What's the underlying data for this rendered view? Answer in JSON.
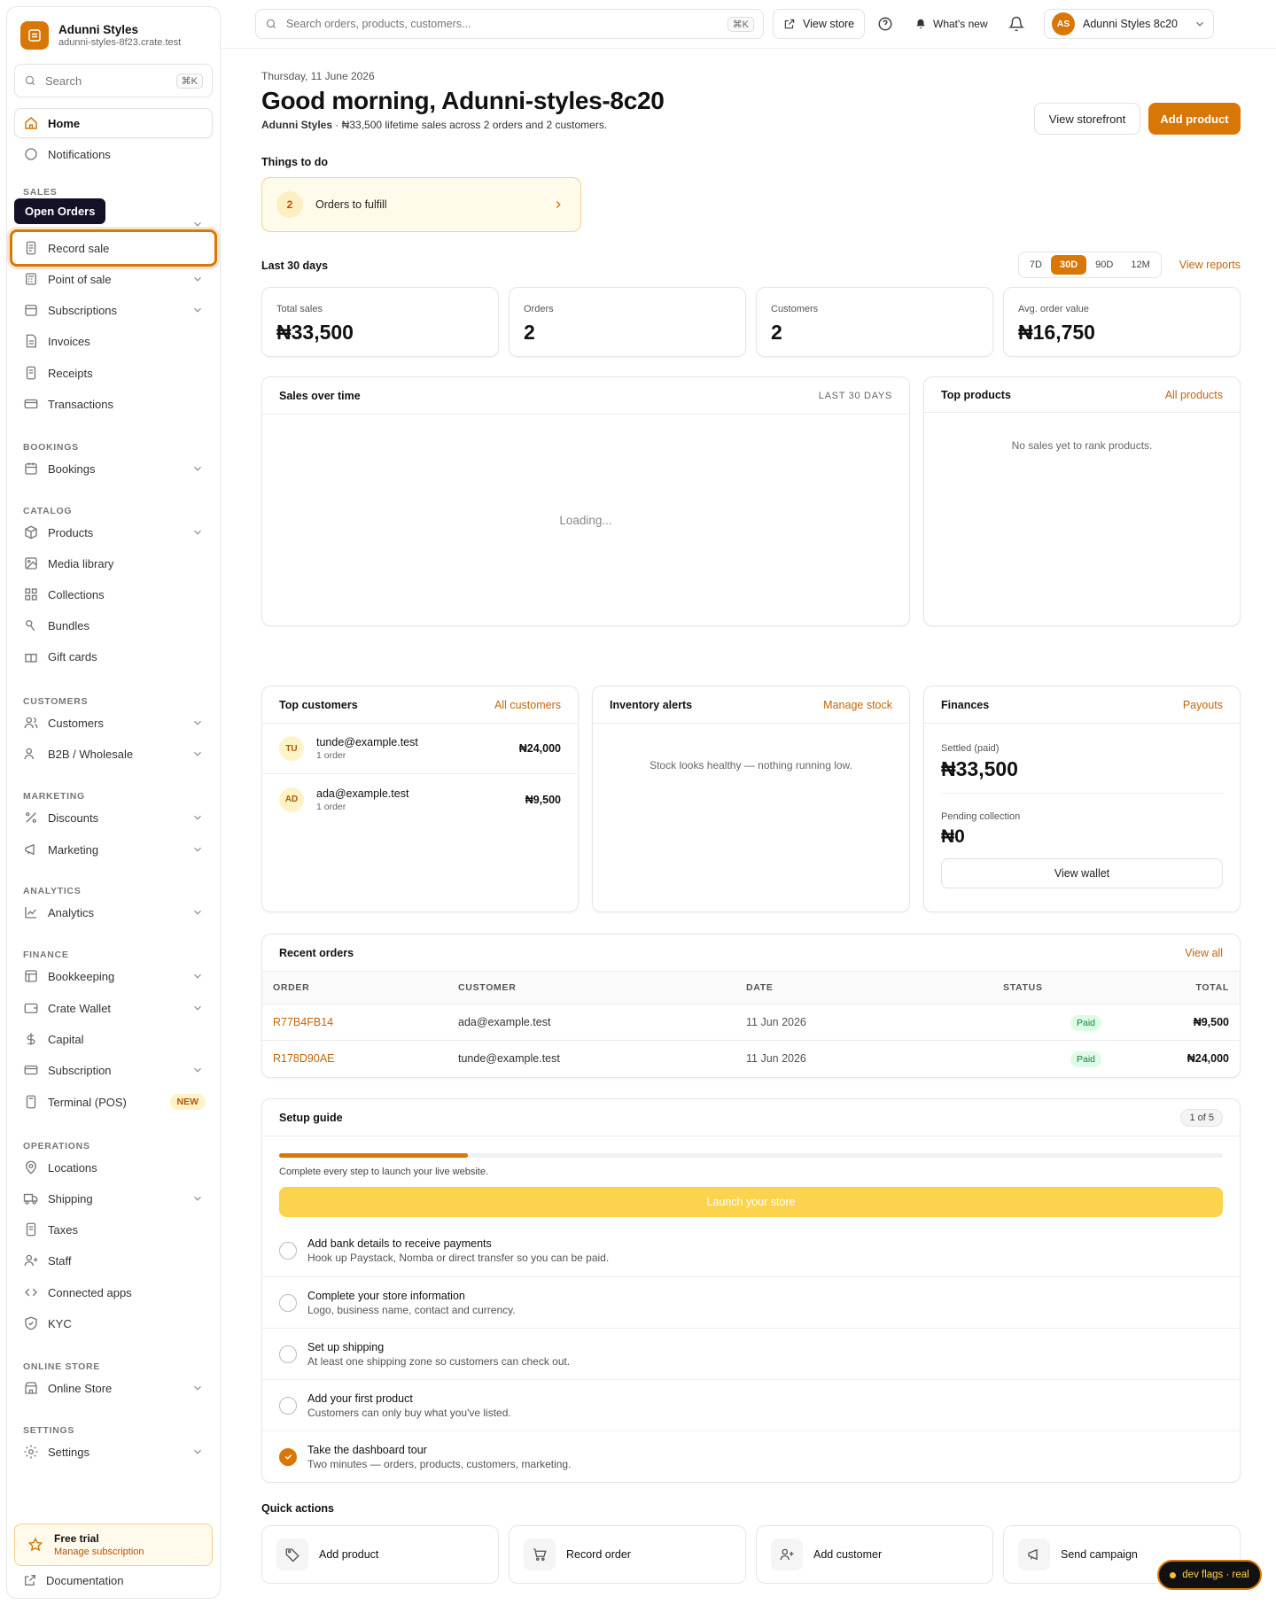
{
  "brand": {
    "name": "Adunni Styles",
    "domain": "adunni-styles-8f23.crate.test"
  },
  "sidebar": {
    "search_placeholder": "Search",
    "search_shortcut": "⌘K",
    "home": "Home",
    "notifications": "Notifications",
    "tooltip": "Open Orders",
    "sections": {
      "sales": "SALES",
      "bookings": "BOOKINGS",
      "catalog": "CATALOG",
      "customers": "CUSTOMERS",
      "marketing": "MARKETING",
      "analytics": "ANALYTICS",
      "finance": "FINANCE",
      "operations": "OPERATIONS",
      "online_store": "ONLINE STORE",
      "settings": "SETTINGS"
    },
    "items": {
      "record_sale": "Record sale",
      "point_of_sale": "Point of sale",
      "subscriptions": "Subscriptions",
      "invoices": "Invoices",
      "receipts": "Receipts",
      "transactions": "Transactions",
      "bookings": "Bookings",
      "products": "Products",
      "media_library": "Media library",
      "collections": "Collections",
      "bundles": "Bundles",
      "gift_cards": "Gift cards",
      "customers": "Customers",
      "b2b": "B2B / Wholesale",
      "discounts": "Discounts",
      "marketing": "Marketing",
      "analytics": "Analytics",
      "bookkeeping": "Bookkeeping",
      "crate_wallet": "Crate Wallet",
      "capital": "Capital",
      "subscription": "Subscription",
      "terminal": "Terminal (POS)",
      "locations": "Locations",
      "shipping": "Shipping",
      "taxes": "Taxes",
      "staff": "Staff",
      "connected_apps": "Connected apps",
      "kyc": "KYC",
      "online_store": "Online Store",
      "settings": "Settings"
    },
    "new_badge": "NEW",
    "trial_title": "Free trial",
    "trial_link": "Manage subscription",
    "documentation": "Documentation"
  },
  "topbar": {
    "search_placeholder": "Search orders, products, customers...",
    "shortcut": "⌘K",
    "view_store": "View store",
    "whats_new": "What's new",
    "avatar_initials": "AS",
    "account_name": "Adunni Styles 8c20"
  },
  "header": {
    "date": "Thursday, 11 June 2026",
    "greeting": "Good morning, Adunni-styles-8c20",
    "store_name": "Adunni Styles",
    "summary": " · ₦33,500 lifetime sales across 2 orders and 2 customers.",
    "view_storefront": "View storefront",
    "add_product": "Add product"
  },
  "todo": {
    "title": "Things to do",
    "count": "2",
    "label": "Orders to fulfill"
  },
  "period": {
    "title": "Last 30 days",
    "options": [
      "7D",
      "30D",
      "90D",
      "12M"
    ],
    "selected": "30D",
    "view_reports": "View reports"
  },
  "stats": [
    {
      "label": "Total sales",
      "value": "₦33,500"
    },
    {
      "label": "Orders",
      "value": "2"
    },
    {
      "label": "Customers",
      "value": "2"
    },
    {
      "label": "Avg. order value",
      "value": "₦16,750"
    }
  ],
  "sales_chart": {
    "title": "Sales over time",
    "range": "LAST 30 DAYS",
    "state": "Loading..."
  },
  "top_products": {
    "title": "Top products",
    "link": "All products",
    "empty": "No sales yet to rank products."
  },
  "top_customers": {
    "title": "Top customers",
    "link": "All customers",
    "rows": [
      {
        "initials": "TU",
        "email": "tunde@example.test",
        "orders": "1 order",
        "amount": "₦24,000"
      },
      {
        "initials": "AD",
        "email": "ada@example.test",
        "orders": "1 order",
        "amount": "₦9,500"
      }
    ]
  },
  "inventory": {
    "title": "Inventory alerts",
    "link": "Manage stock",
    "message": "Stock looks healthy — nothing running low."
  },
  "finances": {
    "title": "Finances",
    "link": "Payouts",
    "settled_label": "Settled (paid)",
    "settled_value": "₦33,500",
    "pending_label": "Pending collection",
    "pending_value": "₦0",
    "wallet_button": "View wallet"
  },
  "recent_orders": {
    "title": "Recent orders",
    "link": "View all",
    "columns": [
      "ORDER",
      "CUSTOMER",
      "DATE",
      "STATUS",
      "TOTAL"
    ],
    "rows": [
      {
        "id": "R77B4FB14",
        "customer": "ada@example.test",
        "date": "11 Jun 2026",
        "status": "Paid",
        "total": "₦9,500"
      },
      {
        "id": "R178D90AE",
        "customer": "tunde@example.test",
        "date": "11 Jun 2026",
        "status": "Paid",
        "total": "₦24,000"
      }
    ]
  },
  "setup": {
    "title": "Setup guide",
    "progress_label": "1 of 5",
    "progress": 0.2,
    "hint": "Complete every step to launch your live website.",
    "launch": "Launch your store",
    "steps": [
      {
        "title": "Add bank details to receive payments",
        "desc": "Hook up Paystack, Nomba or direct transfer so you can be paid."
      },
      {
        "title": "Complete your store information",
        "desc": "Logo, business name, contact and currency."
      },
      {
        "title": "Set up shipping",
        "desc": "At least one shipping zone so customers can check out."
      },
      {
        "title": "Add your first product",
        "desc": "Customers can only buy what you've listed."
      },
      {
        "title": "Take the dashboard tour",
        "desc": "Two minutes — orders, products, customers, marketing."
      }
    ]
  },
  "quick_actions": {
    "title": "Quick actions",
    "items": [
      "Add product",
      "Record order",
      "Add customer",
      "Send campaign"
    ]
  },
  "dev_flags": "dev flags · real",
  "colors": {
    "accent": "#d97706",
    "launch": "#fcd34d",
    "paid": "#15803d"
  }
}
